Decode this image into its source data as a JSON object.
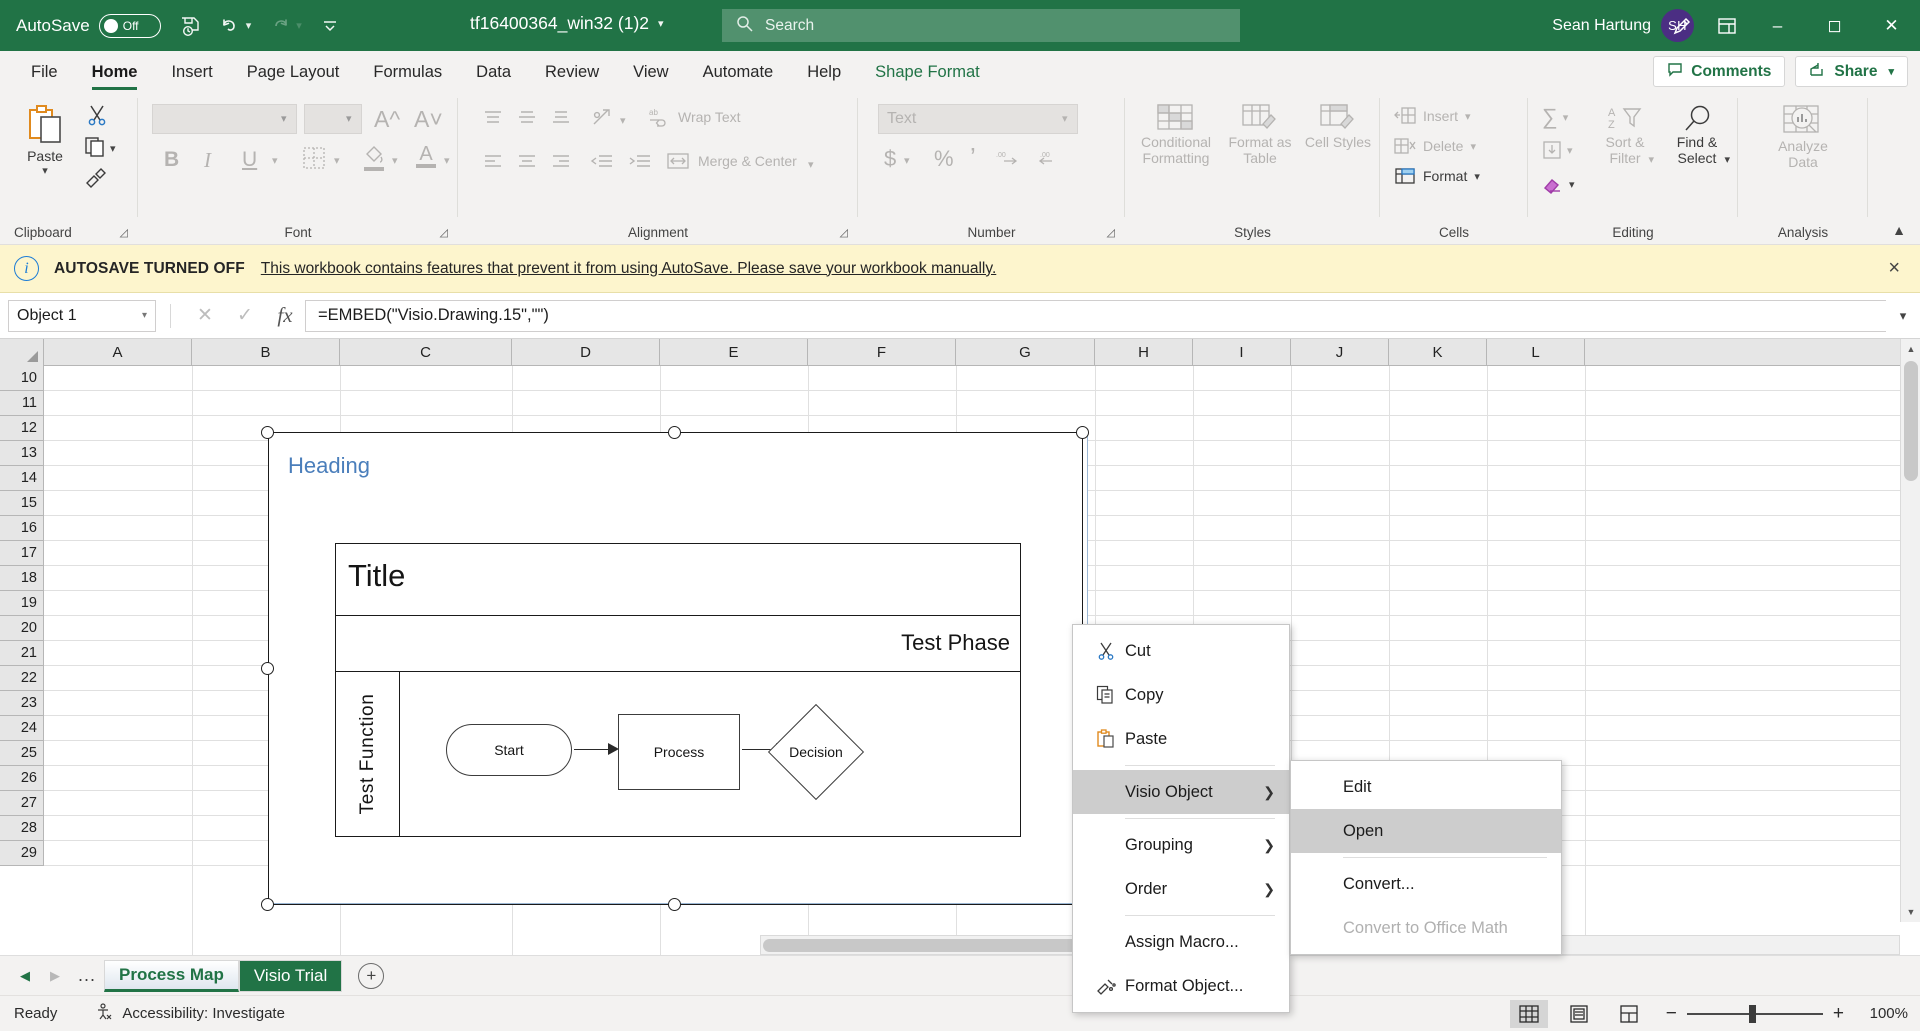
{
  "titlebar": {
    "autosave_label": "AutoSave",
    "autosave_state": "Off",
    "document_title": "tf16400364_win32 (1)2",
    "search_placeholder": "Search",
    "user_name": "Sean Hartung",
    "user_initials": "SH",
    "icons": [
      "save-icon",
      "undo-icon",
      "redo-icon",
      "customize-quick-access-icon"
    ],
    "window_controls": [
      "minimize",
      "restore",
      "close"
    ],
    "brand_color": "#217346"
  },
  "tabs": {
    "items": [
      {
        "label": "File",
        "active": false
      },
      {
        "label": "Home",
        "active": true
      },
      {
        "label": "Insert",
        "active": false
      },
      {
        "label": "Page Layout",
        "active": false
      },
      {
        "label": "Formulas",
        "active": false
      },
      {
        "label": "Data",
        "active": false
      },
      {
        "label": "Review",
        "active": false
      },
      {
        "label": "View",
        "active": false
      },
      {
        "label": "Automate",
        "active": false
      },
      {
        "label": "Help",
        "active": false
      },
      {
        "label": "Shape Format",
        "active": false,
        "contextual": true
      }
    ],
    "comments_label": "Comments",
    "share_label": "Share"
  },
  "ribbon": {
    "groups": [
      {
        "name": "Clipboard"
      },
      {
        "name": "Font"
      },
      {
        "name": "Alignment"
      },
      {
        "name": "Number"
      },
      {
        "name": "Styles"
      },
      {
        "name": "Cells"
      },
      {
        "name": "Editing"
      },
      {
        "name": "Analysis"
      }
    ],
    "clipboard": {
      "paste_label": "Paste"
    },
    "font": {
      "bold": "B",
      "italic": "I",
      "underline": "U",
      "grow_font": "A",
      "shrink_font": "A"
    },
    "alignment": {
      "wrap_text": "Wrap Text",
      "merge_center": "Merge & Center"
    },
    "number": {
      "format_value": "Text",
      "currency": "$",
      "percent": "%",
      "comma": "’",
      "increase_decimal": "+.0",
      "decrease_decimal": "-.00"
    },
    "styles": {
      "conditional_formatting": "Conditional Formatting",
      "format_as_table": "Format as Table",
      "cell_styles": "Cell Styles"
    },
    "cells": {
      "insert": "Insert",
      "delete": "Delete",
      "format": "Format"
    },
    "editing": {
      "sort_filter": "Sort & Filter",
      "find_select": "Find & Select"
    },
    "analysis": {
      "analyze_data": "Analyze Data"
    }
  },
  "message_bar": {
    "title": "AUTOSAVE TURNED OFF",
    "message": "This workbook contains features that prevent it from using AutoSave. Please save your workbook manually.",
    "close_label": "×",
    "background": "#fdf5cd"
  },
  "formula_bar": {
    "name_box_value": "Object 1",
    "cancel_icon": "✕",
    "enter_icon": "✓",
    "function_icon": "fx",
    "formula_value": "=EMBED(\"Visio.Drawing.15\",\"\")"
  },
  "grid": {
    "columns": [
      "A",
      "B",
      "C",
      "D",
      "E",
      "F",
      "G",
      "H",
      "I",
      "J",
      "K",
      "L"
    ],
    "rows": [
      "10",
      "11",
      "12",
      "13",
      "14",
      "15",
      "16",
      "17",
      "18",
      "19",
      "20",
      "21",
      "22",
      "23",
      "24",
      "25",
      "26",
      "27",
      "28",
      "29"
    ]
  },
  "visio_object": {
    "heading": "Heading",
    "title": "Title",
    "phase": "Test Phase",
    "function_lane": "Test Function",
    "shapes": [
      {
        "label": "Start",
        "type": "terminator"
      },
      {
        "label": "Process",
        "type": "process"
      },
      {
        "label": "Decision",
        "type": "decision"
      }
    ]
  },
  "context_menu": {
    "items": [
      {
        "label": "Cut",
        "icon": "scissors-icon",
        "accel_index": 2,
        "submenu": false
      },
      {
        "label": "Copy",
        "icon": "copy-icon",
        "accel_index": 0,
        "submenu": false
      },
      {
        "label": "Paste",
        "icon": "paste-icon",
        "accel_index": 0,
        "submenu": false
      },
      {
        "label": "Visio Object",
        "icon": "",
        "accel_index": 6,
        "submenu": true,
        "highlighted": true
      },
      {
        "label": "Grouping",
        "icon": "",
        "accel_index": 0,
        "submenu": true
      },
      {
        "label": "Order",
        "icon": "",
        "accel_index": 1,
        "submenu": true
      },
      {
        "label": "Assign Macro...",
        "icon": "",
        "accel_index": 8,
        "submenu": false
      },
      {
        "label": "Format Object...",
        "icon": "format-object-icon",
        "accel_index": 0,
        "submenu": false
      }
    ]
  },
  "submenu": {
    "items": [
      {
        "label": "Edit",
        "accel_index": 0,
        "disabled": false,
        "highlighted": false
      },
      {
        "label": "Open",
        "accel_index": 0,
        "disabled": false,
        "highlighted": true
      },
      {
        "label": "Convert...",
        "accel_index": 4,
        "disabled": false,
        "highlighted": false
      },
      {
        "label": "Convert to Office Math",
        "accel_index": 4,
        "disabled": true,
        "highlighted": false
      }
    ]
  },
  "sheet_bar": {
    "overflow": "...",
    "sheets": [
      {
        "label": "Process Map",
        "active": true,
        "green": false
      },
      {
        "label": "Visio Trial",
        "active": false,
        "green": true
      }
    ],
    "add_label": "+"
  },
  "status_bar": {
    "state": "Ready",
    "accessibility": "Accessibility: Investigate",
    "views": [
      "normal-view-icon",
      "page-layout-view-icon",
      "page-break-preview-icon"
    ],
    "zoom_out": "−",
    "zoom_in": "+",
    "zoom_level": "100%"
  }
}
